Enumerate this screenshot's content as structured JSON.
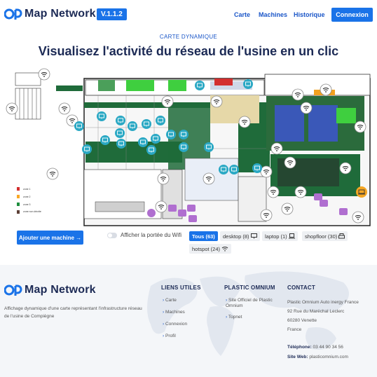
{
  "header": {
    "app_name": "Map Network",
    "version": "V.1.1.2",
    "nav": [
      "Carte",
      "Machines",
      "Historique"
    ],
    "login_label": "Connexion"
  },
  "hero": {
    "eyebrow": "CARTE DYNAMIQUE",
    "title": "Visualisez l'activité du réseau de l'usine en un clic"
  },
  "map": {
    "legend": [
      {
        "label": "zone 1",
        "color": "#d32f2f"
      },
      {
        "label": "zone 2",
        "color": "#f9a825"
      },
      {
        "label": "zone 3",
        "color": "#1e8e3e"
      },
      {
        "label": "zone non décrite",
        "color": "#5d4037"
      }
    ],
    "device_colors": {
      "hotspot": "#ffffff",
      "desktop": "#2aa8c4",
      "laptop": "#f5a623",
      "shopfloor": "#b06fd0"
    }
  },
  "controls": {
    "add_machine_label": "Ajouter une machine →",
    "wifi_toggle_label": "Afficher la portée du Wifi",
    "filters": [
      {
        "label": "Tous (63)",
        "icon": ""
      },
      {
        "label": "desktop (8)",
        "icon": "monitor-icon"
      },
      {
        "label": "laptop (1)",
        "icon": "laptop-icon"
      },
      {
        "label": "shopfloor (30)",
        "icon": "printer-icon"
      },
      {
        "label": "hotspot (24)",
        "icon": "wifi-icon"
      }
    ]
  },
  "footer": {
    "app_name": "Map Network",
    "description": "Affichage dynamique d'une carte représentant l'infrastructure réseau de l'usine de Compiègne",
    "col1": {
      "title": "LIENS UTILES",
      "links": [
        "Carte",
        "Machines",
        "Connexion",
        "Profil"
      ]
    },
    "col2": {
      "title": "PLASTIC OMNIUM",
      "links": [
        "Site Officiel de Plastic Omnium",
        "Topnet"
      ]
    },
    "col3": {
      "title": "CONTACT",
      "lines": [
        "Plastic Omnium Auto inergy France",
        "92 Rue du Maréchal Leclerc",
        "60280 Venette",
        "France"
      ],
      "phone_label": "Téléphone:",
      "phone": "03 44 90 34 56",
      "web_label": "Site Web:",
      "web": "plasticomnium.com"
    }
  }
}
